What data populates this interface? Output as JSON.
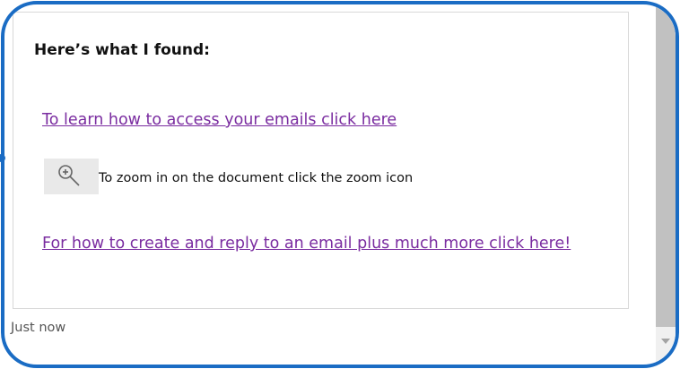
{
  "message": {
    "heading": "Here’s what I found:",
    "link_access_emails": "To learn how to access your emails click here",
    "zoom_text": "To zoom in on the document click the zoom icon",
    "link_create_reply": "For how to create and reply to an email plus much more click here!",
    "timestamp": "Just now"
  },
  "icons": {
    "zoom": "zoom-in-icon",
    "scroll_down": "chevron-down-icon"
  },
  "colors": {
    "frame_border": "#1a6cc4",
    "link": "#7a2ca0",
    "text": "#111111",
    "timestamp": "#555555",
    "scrollbar_thumb": "#c1c1c1"
  }
}
